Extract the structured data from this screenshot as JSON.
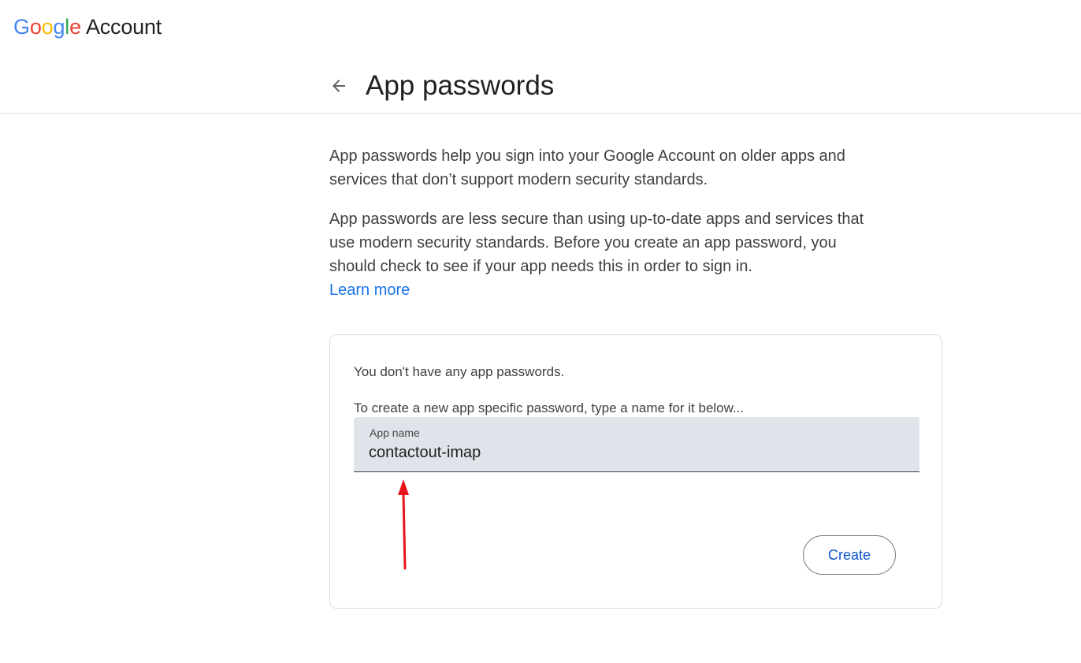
{
  "header": {
    "logo_letters": [
      "G",
      "o",
      "o",
      "g",
      "l",
      "e"
    ],
    "logo_product": "Account",
    "back_icon": "arrow-left-icon",
    "title": "App passwords"
  },
  "intro": {
    "paragraph1": "App passwords help you sign into your Google Account on older apps and services that don’t support modern security standards.",
    "paragraph2": "App passwords are less secure than using up-to-date apps and services that use modern security standards. Before you create an app password, you should check to see if your app needs this in order to sign in.",
    "learn_more": "Learn more"
  },
  "card": {
    "empty_message": "You don't have any app passwords.",
    "create_hint": "To create a new app specific password, type a name for it below...",
    "app_name_label": "App name",
    "app_name_value": "contactout-imap",
    "create_button": "Create"
  },
  "annotation": {
    "icon": "red-arrow-icon",
    "color": "#e8131a"
  },
  "colors": {
    "link": "#1a73e8",
    "button_text": "#0b57d0",
    "field_background": "#dfe3ea",
    "google_blue": "#4285f4",
    "google_red": "#ea4335",
    "google_yellow": "#fbbc05",
    "google_green": "#34a853"
  }
}
